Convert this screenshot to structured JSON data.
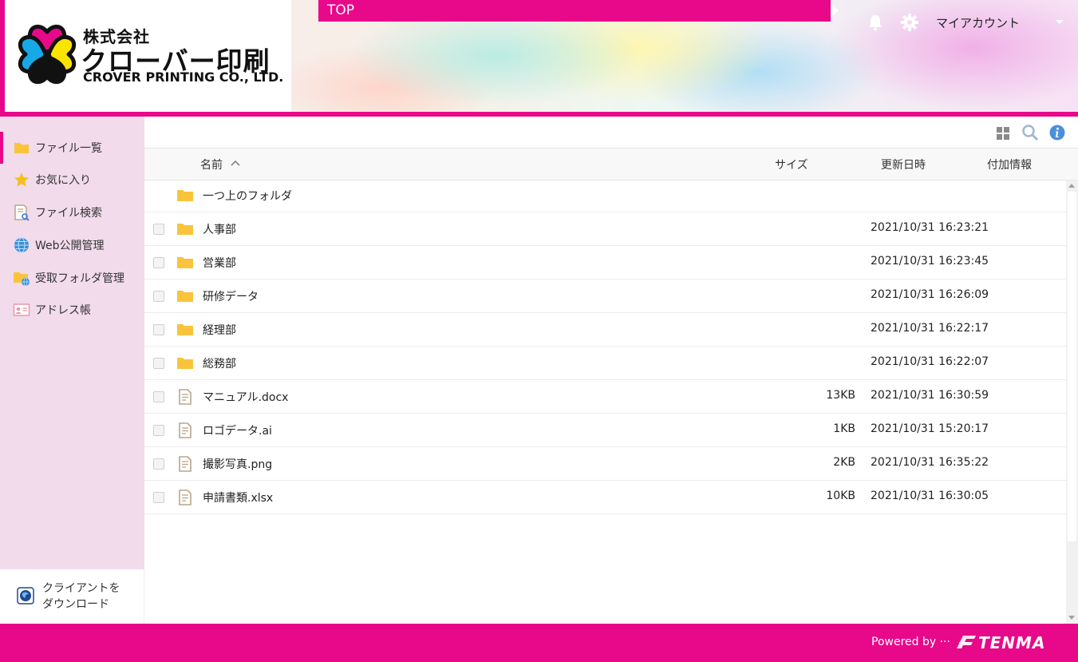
{
  "header": {
    "company_sub": "株式会社",
    "company_main": "クローバー印刷",
    "company_en": "CROVER PRINTING CO., LTD.",
    "breadcrumb": "TOP",
    "account_label": "マイアカウント",
    "icons": [
      "bell-icon",
      "gear-icon",
      "chevron-down-icon"
    ]
  },
  "sidebar": {
    "items": [
      {
        "label": "ファイル一覧",
        "icon": "folder-icon",
        "active": true
      },
      {
        "label": "お気に入り",
        "icon": "star-icon"
      },
      {
        "label": "ファイル検索",
        "icon": "file-search-icon"
      },
      {
        "label": "Web公開管理",
        "icon": "globe-icon"
      },
      {
        "label": "受取フォルダ管理",
        "icon": "folder-globe-icon"
      },
      {
        "label": "アドレス帳",
        "icon": "address-card-icon"
      }
    ],
    "download": {
      "line1": "クライアントを",
      "line2": "ダウンロード",
      "icon": "download-client-icon"
    }
  },
  "toolbar": {
    "icons": [
      "grid-view-icon",
      "search-icon",
      "info-icon"
    ]
  },
  "table": {
    "columns": {
      "name": "名前",
      "size": "サイズ",
      "date": "更新日時",
      "extra": "付加情報"
    },
    "up_folder": "一つ上のフォルダ",
    "rows": [
      {
        "name": "人事部",
        "type": "folder",
        "size": "",
        "date": "2021/10/31 16:23:21"
      },
      {
        "name": "営業部",
        "type": "folder",
        "size": "",
        "date": "2021/10/31 16:23:45"
      },
      {
        "name": "研修データ",
        "type": "folder",
        "size": "",
        "date": "2021/10/31 16:26:09"
      },
      {
        "name": "経理部",
        "type": "folder",
        "size": "",
        "date": "2021/10/31 16:22:17"
      },
      {
        "name": "総務部",
        "type": "folder",
        "size": "",
        "date": "2021/10/31 16:22:07"
      },
      {
        "name": "マニュアル.docx",
        "type": "file",
        "size": "13KB",
        "date": "2021/10/31 16:30:59"
      },
      {
        "name": "ロゴデータ.ai",
        "type": "file",
        "size": "1KB",
        "date": "2021/10/31 15:20:17"
      },
      {
        "name": "撮影写真.png",
        "type": "file",
        "size": "2KB",
        "date": "2021/10/31 16:35:22"
      },
      {
        "name": "申請書類.xlsx",
        "type": "file",
        "size": "10KB",
        "date": "2021/10/31 16:30:05"
      }
    ]
  },
  "footer": {
    "powered_by": "Powered by ···",
    "brand": "TENMA"
  },
  "colors": {
    "accent": "#e8088a",
    "sidebar_bg": "#f2dbeb",
    "folder": "#f9c43c",
    "file_icon": "#b9a58a",
    "info": "#4a90d9"
  }
}
